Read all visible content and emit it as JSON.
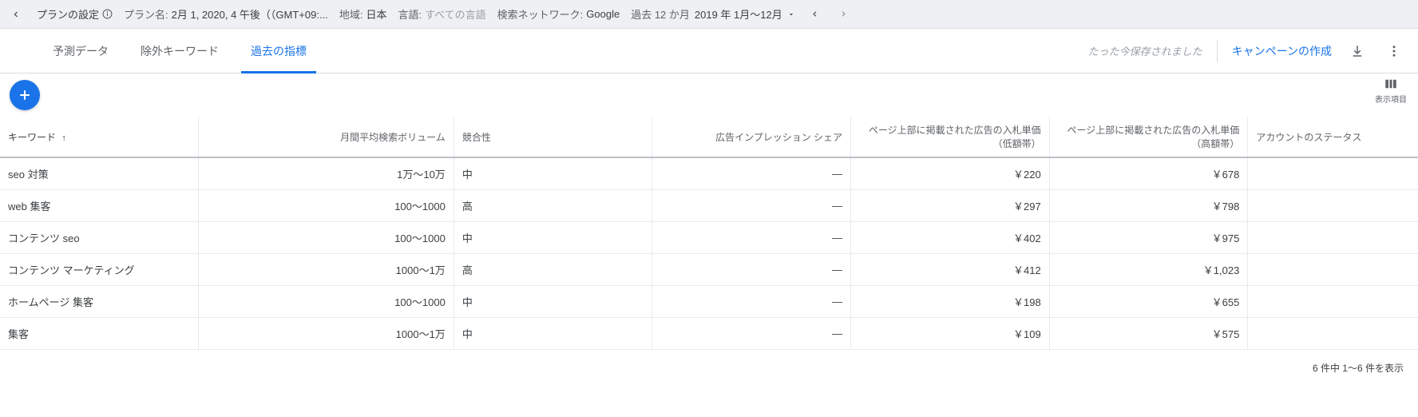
{
  "topbar": {
    "plan_settings_label": "プランの設定",
    "plan_name_label": "プラン名:",
    "plan_name_value": "2月 1, 2020, 4 午後（（GMT+09:...",
    "region_label": "地域:",
    "region_value": "日本",
    "language_label": "言語:",
    "language_value": "すべての言語",
    "network_label": "検索ネットワーク:",
    "network_value": "Google",
    "period_label": "過去 12 か月",
    "period_value": "2019 年 1月～12月"
  },
  "tabs": {
    "forecast": "予測データ",
    "negative": "除外キーワード",
    "historical": "過去の指標"
  },
  "subhead": {
    "saved_note": "たった今保存されました",
    "create_campaign": "キャンペーンの作成"
  },
  "columns_button_label": "表示項目",
  "table": {
    "headers": {
      "keyword": "キーワード",
      "volume": "月間平均検索ボリューム",
      "competition": "競合性",
      "impression_share": "広告インプレッション シェア",
      "bid_low": "ページ上部に掲載された広告の入札単価（低額帯）",
      "bid_high": "ページ上部に掲載された広告の入札単価（高額帯）",
      "account_status": "アカウントのステータス"
    },
    "rows": [
      {
        "keyword": "seo 対策",
        "volume": "1万～10万",
        "competition": "中",
        "impression_share": "—",
        "bid_low": "￥220",
        "bid_high": "￥678",
        "account_status": ""
      },
      {
        "keyword": "web 集客",
        "volume": "100～1000",
        "competition": "高",
        "impression_share": "—",
        "bid_low": "￥297",
        "bid_high": "￥798",
        "account_status": ""
      },
      {
        "keyword": "コンテンツ seo",
        "volume": "100～1000",
        "competition": "中",
        "impression_share": "—",
        "bid_low": "￥402",
        "bid_high": "￥975",
        "account_status": ""
      },
      {
        "keyword": "コンテンツ マーケティング",
        "volume": "1000～1万",
        "competition": "高",
        "impression_share": "—",
        "bid_low": "￥412",
        "bid_high": "￥1,023",
        "account_status": ""
      },
      {
        "keyword": "ホームページ 集客",
        "volume": "100～1000",
        "competition": "中",
        "impression_share": "—",
        "bid_low": "￥198",
        "bid_high": "￥655",
        "account_status": ""
      },
      {
        "keyword": "集客",
        "volume": "1000～1万",
        "competition": "中",
        "impression_share": "—",
        "bid_low": "￥109",
        "bid_high": "￥575",
        "account_status": ""
      }
    ]
  },
  "pager": {
    "text": "6 件中 1～6 件を表示"
  }
}
